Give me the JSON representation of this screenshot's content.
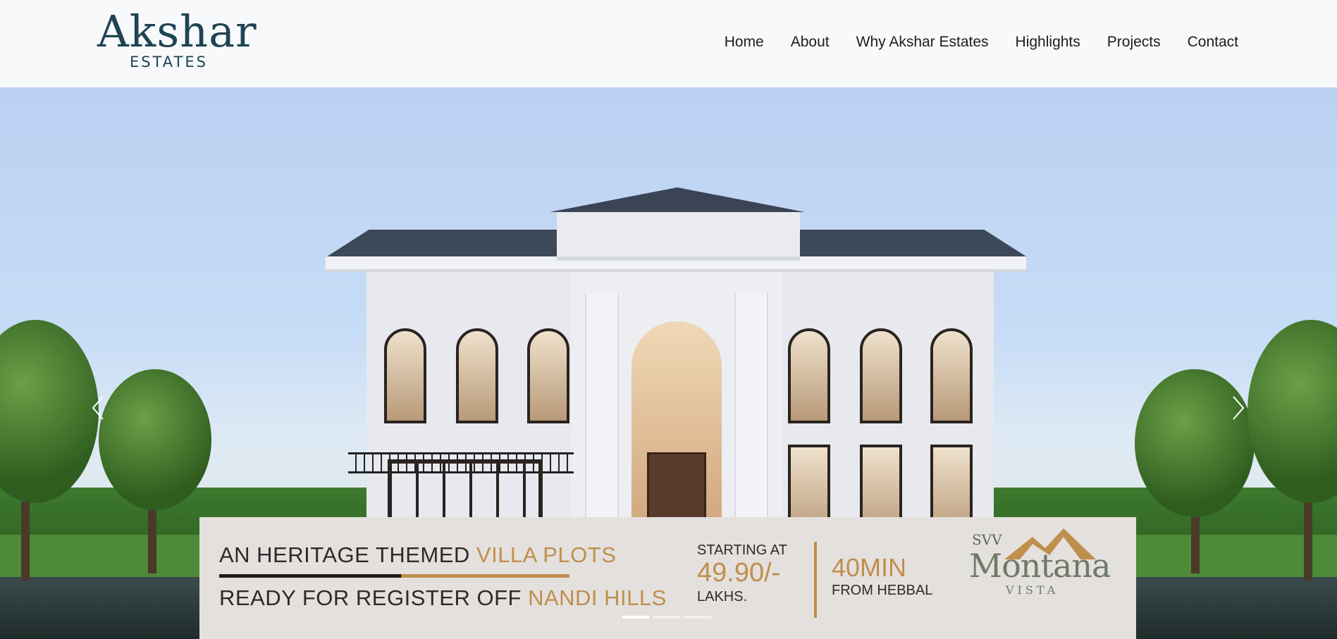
{
  "brand": {
    "logo_main": "Akshar",
    "logo_sub": "ESTATES"
  },
  "nav": {
    "items": [
      "Home",
      "About",
      "Why Akshar Estates",
      "Highlights",
      "Projects",
      "Contact"
    ]
  },
  "slider": {
    "prev_icon": "chevron-left-icon",
    "next_icon": "chevron-right-icon",
    "active_slide": 1,
    "slide_count": 3
  },
  "banner": {
    "headline_prefix": "AN HERITAGE THEMED ",
    "headline_highlight": "VILLA PLOTS",
    "subline_prefix": "READY FOR REGISTER OFF ",
    "subline_highlight": "NANDI HILLS",
    "price_label": "STARTING AT",
    "price_value": "49.90/-",
    "price_unit": "LAKHS.",
    "distance_value": "40MIN",
    "distance_label": "FROM HEBBAL",
    "project_logo": {
      "prefix": "SVV",
      "name": "Montana",
      "suffix": "VISTA"
    }
  },
  "colors": {
    "accent_gold": "#bf8f4d",
    "logo_teal": "#1f4453",
    "banner_bg": "#e4e0dd"
  }
}
